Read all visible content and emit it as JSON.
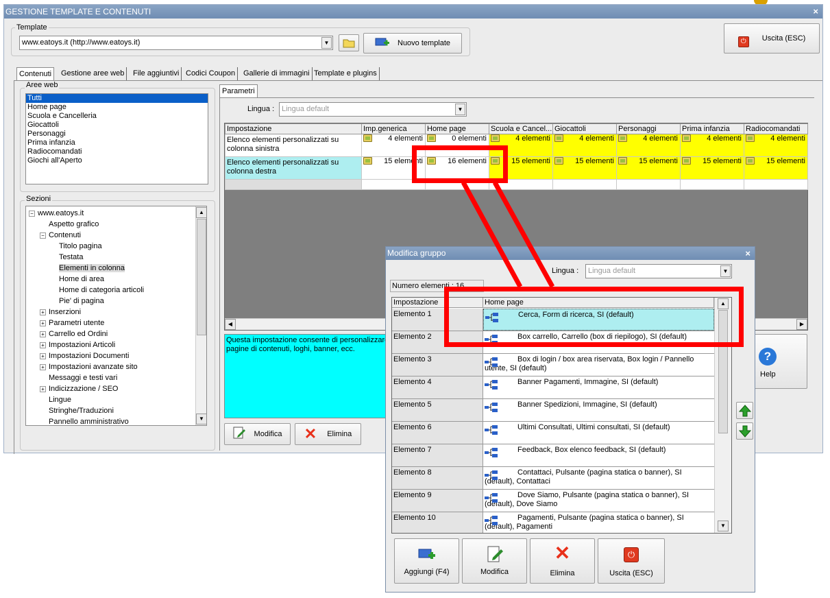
{
  "window": {
    "title": "GESTIONE TEMPLATE E CONTENUTI",
    "close": "×"
  },
  "template": {
    "group_label": "Template",
    "selected": "www.eatoys.it (http://www.eatoys.it)",
    "new_button": "Nuovo template"
  },
  "exit_button": "Uscita (ESC)",
  "tabs": [
    "Contenuti",
    "Gestione aree web",
    "File aggiuntivi",
    "Codici Coupon",
    "Gallerie di immagini",
    "Template e plugins"
  ],
  "aree_web": {
    "label": "Aree web",
    "items": [
      "Tutti",
      "Home page",
      "Scuola e Cancelleria",
      "Giocattoli",
      "Personaggi",
      "Prima infanzia",
      "Radiocomandati",
      "Giochi all'Aperto"
    ]
  },
  "sezioni": {
    "label": "Sezioni",
    "root": "www.eatoys.it",
    "nodes": [
      {
        "label": "Aspetto grafico",
        "level": 1,
        "exp": ""
      },
      {
        "label": "Contenuti",
        "level": 1,
        "exp": "−"
      },
      {
        "label": "Titolo pagina",
        "level": 2,
        "exp": ""
      },
      {
        "label": "Testata",
        "level": 2,
        "exp": ""
      },
      {
        "label": "Elementi in colonna",
        "level": 2,
        "exp": "",
        "selected": true
      },
      {
        "label": "Home di area",
        "level": 2,
        "exp": ""
      },
      {
        "label": "Home di categoria articoli",
        "level": 2,
        "exp": ""
      },
      {
        "label": "Pie' di pagina",
        "level": 2,
        "exp": ""
      },
      {
        "label": "Inserzioni",
        "level": 1,
        "exp": "+"
      },
      {
        "label": "Parametri utente",
        "level": 1,
        "exp": "+"
      },
      {
        "label": "Carrello ed Ordini",
        "level": 1,
        "exp": "+"
      },
      {
        "label": "Impostazioni Articoli",
        "level": 1,
        "exp": "+"
      },
      {
        "label": "Impostazioni Documenti",
        "level": 1,
        "exp": "+"
      },
      {
        "label": "Impostazioni avanzate sito",
        "level": 1,
        "exp": "+"
      },
      {
        "label": "Messaggi e testi vari",
        "level": 1,
        "exp": ""
      },
      {
        "label": "Indicizzazione / SEO",
        "level": 1,
        "exp": "+"
      },
      {
        "label": "Lingue",
        "level": 1,
        "exp": ""
      },
      {
        "label": "Stringhe/Traduzioni",
        "level": 1,
        "exp": ""
      },
      {
        "label": "Pannello amministrativo",
        "level": 1,
        "exp": ""
      }
    ]
  },
  "parametri": {
    "tab": "Parametri",
    "lingua_label": "Lingua :",
    "lingua_value": "Lingua default",
    "columns": [
      "Impostazione",
      "Imp.generica",
      "Home page",
      "Scuola e Cancel...",
      "Giocattoli",
      "Personaggi",
      "Prima infanzia",
      "Radiocomandati"
    ],
    "rows": [
      {
        "name_line1": "Elenco elementi personalizzati su",
        "name_line2": "colonna sinistra",
        "values": [
          "4 elementi",
          "0 elementi",
          "4 elementi",
          "4 elementi",
          "4 elementi",
          "4 elementi",
          "4 elementi"
        ]
      },
      {
        "name_line1": "Elenco elementi personalizzati su",
        "name_line2": "colonna destra",
        "values": [
          "15 elementi",
          "16 elementi",
          "15 elementi",
          "15 elementi",
          "15 elementi",
          "15 elementi",
          "15 elementi"
        ]
      }
    ],
    "description_line1": "Questa impostazione consente di personalizzare",
    "description_line2": "pagine di contenuti, loghi, banner, ecc.",
    "modifica": "Modifica",
    "elimina": "Elimina",
    "help": "Help"
  },
  "dialog": {
    "title": "Modifica gruppo",
    "close": "×",
    "lingua_label": "Lingua :",
    "lingua_value": "Lingua default",
    "count": "Numero elementi : 16",
    "col1": "Impostazione",
    "col2": "Home page",
    "rows": [
      {
        "name": "Elemento 1",
        "l1": "Cerca, Form di ricerca, SI (default)",
        "l2": ""
      },
      {
        "name": "Elemento 2",
        "l1": "Box carrello, Carrello (box di riepilogo), SI (default)",
        "l2": ""
      },
      {
        "name": "Elemento 3",
        "l1": "Box di login / box area riservata, Box login / Pannello",
        "l2": "utente, SI (default)"
      },
      {
        "name": "Elemento 4",
        "l1": "Banner Pagamenti, Immagine, SI (default)",
        "l2": ""
      },
      {
        "name": "Elemento 5",
        "l1": "Banner Spedizioni, Immagine, SI (default)",
        "l2": ""
      },
      {
        "name": "Elemento 6",
        "l1": "Ultimi Consultati, Ultimi consultati, SI (default)",
        "l2": ""
      },
      {
        "name": "Elemento 7",
        "l1": "Feedback, Box elenco feedback, SI (default)",
        "l2": ""
      },
      {
        "name": "Elemento 8",
        "l1": "Contattaci, Pulsante (pagina statica o banner), SI",
        "l2": "(default), Contattaci"
      },
      {
        "name": "Elemento 9",
        "l1": "Dove Siamo, Pulsante (pagina statica o banner), SI",
        "l2": "(default), Dove Siamo"
      },
      {
        "name": "Elemento 10",
        "l1": "Pagamenti, Pulsante (pagina statica o banner), SI",
        "l2": "(default), Pagamenti"
      }
    ],
    "buttons": [
      "Aggiungi (F4)",
      "Modifica",
      "Elimina",
      "Uscita (ESC)"
    ]
  },
  "colors": {
    "highlight_yellow": "#ffff00",
    "highlight_cyan": "#aeeef0",
    "annotation_red": "#ff0000",
    "selection_blue": "#0a5fc8"
  }
}
